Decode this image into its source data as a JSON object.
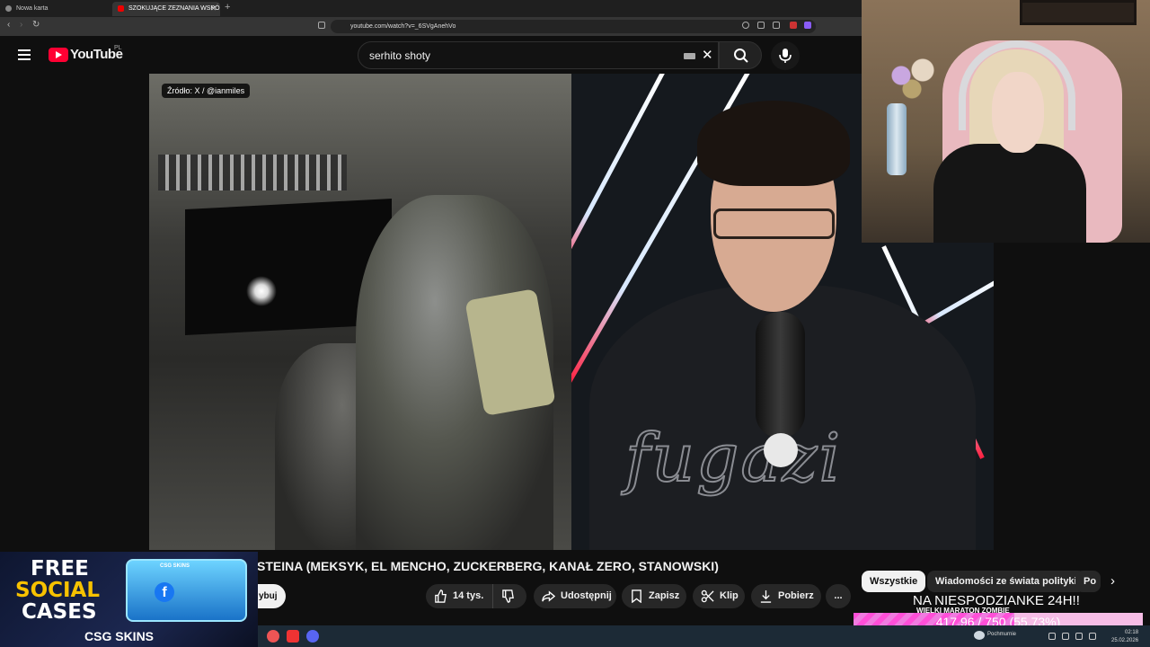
{
  "browser": {
    "tabs": [
      {
        "title": "Nowa karta"
      },
      {
        "title": "SZOKUJĄCE ZEZNANIA WSPÓ"
      }
    ],
    "url": "youtube.com/watch?v=_6SVgAnehVo"
  },
  "youtube": {
    "logo_text": "YouTube",
    "country_code": "PL",
    "search_value": "serhito shoty"
  },
  "video": {
    "source_badge": "Źródło: X / @ianmiles",
    "hoodie_text": "fugazi",
    "title_visible": "STEINA (MEKSYK, EL MENCHO, ZUCKERBERG, KANAŁ ZERO, STANOWSKI)",
    "subscribe_fragment": "ybuj"
  },
  "actions": {
    "likes": "14 tys.",
    "share": "Udostępnij",
    "save": "Zapisz",
    "clip": "Klip",
    "download": "Pobierz",
    "more": "..."
  },
  "chips": [
    "Wszystkie",
    "Wiadomości ze świata polityki",
    "Po"
  ],
  "overlay": {
    "promo_line1": "FREE",
    "promo_line2": "SOCIAL",
    "promo_line3": "CASES",
    "promo_brand": "CSG SKINS",
    "promo_box_label": "CSG SKINS",
    "promo_fb_letter": "f",
    "goal_title": "NA NIESPODZIANKE 24H!!",
    "goal_subtitle": "WIELKI MARATON ZOMBIE",
    "goal_current": 417.96,
    "goal_target": 750,
    "goal_label": "417.96 / 750 (55.73%)"
  },
  "taskbar": {
    "weather": "Pochmurnie",
    "time": "02:18",
    "date": "25.02.2026"
  },
  "colors": {
    "accent": "#ff0033",
    "goal_fill": "#ff4fd8",
    "background": "#0f0f0f"
  }
}
